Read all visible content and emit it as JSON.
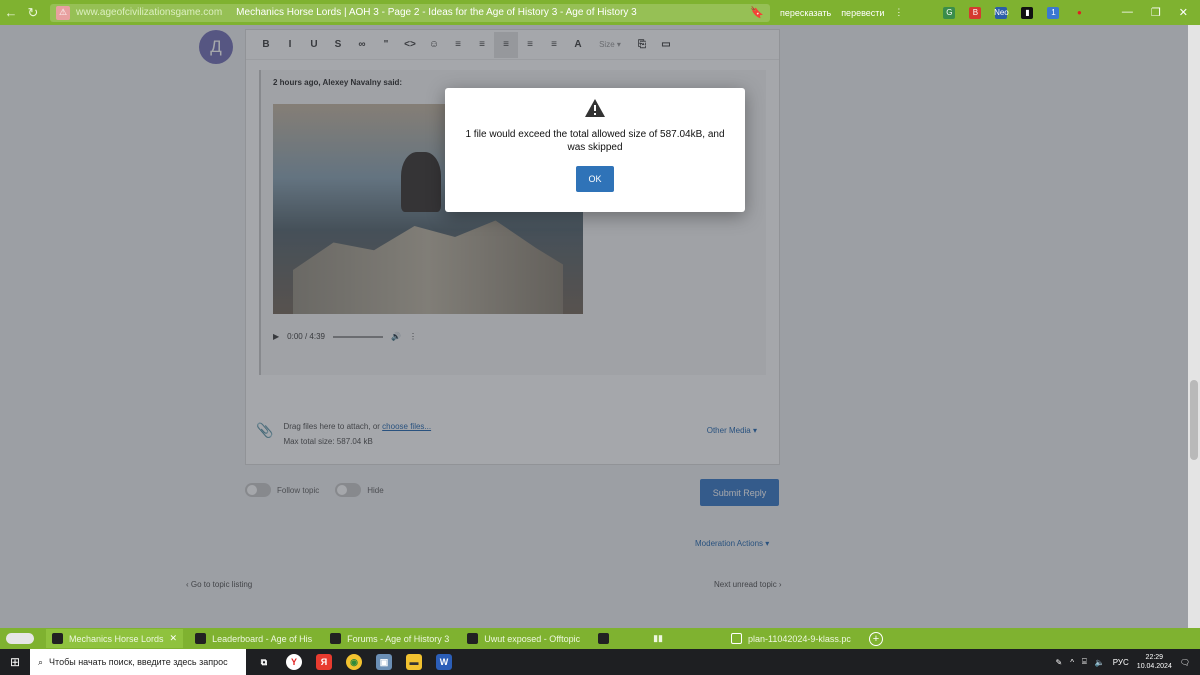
{
  "browser": {
    "back": "←",
    "reload": "↻",
    "warn": "⚠",
    "url_host": "www.ageofcivilizationsgame.com",
    "page_title": "Mechanics Horse Lords | AOH 3 - Page 2 - Ideas for the Age of History 3 - Age of History 3",
    "bookmark": "🔖",
    "ext_retell": "пересказать",
    "ext_translate": "перевести",
    "menu": "⋮",
    "ext_icons": [
      "G",
      "B",
      "Neo",
      "▮",
      "1",
      "●"
    ],
    "win_controls": [
      "—",
      "❐",
      "✕"
    ]
  },
  "page": {
    "avatar_letter": "Д",
    "toolbar": [
      "B",
      "I",
      "U",
      "S",
      "∞",
      "\"",
      "<>",
      "☺",
      "≡",
      "≡",
      "≡",
      "≡",
      "≡",
      "A",
      "Size ▾",
      "⎘",
      "▭"
    ],
    "quote_cite": "2 hours ago, Alexey Navalny said:",
    "audio_time": "0:00 / 4:39",
    "attach_text": "Drag files here to attach, or",
    "attach_link": "choose files...",
    "max_size": "Max total size: 587.04 kB",
    "other_media": "Other Media ▾",
    "follow_topic": "Follow topic",
    "hide": "Hide",
    "submit": "Submit Reply",
    "moderation": "Moderation Actions ▾",
    "goto_topic": "Go to topic listing",
    "next_topic": "Next unread topic"
  },
  "modal": {
    "message": "1 file would exceed the total allowed size of 587.04kB, and was skipped",
    "ok": "OK"
  },
  "tabs": [
    {
      "label": "Mechanics Horse Lords",
      "close": "✕",
      "active": true
    },
    {
      "label": "Leaderboard - Age of His",
      "active": false
    },
    {
      "label": "Forums - Age of History 3",
      "active": false
    },
    {
      "label": "Uwut exposed - Offtopic",
      "active": false
    },
    {
      "label": "",
      "active": false
    },
    {
      "label": "▮▮",
      "active": false
    },
    {
      "label": "plan-11042024-9-klass.pc",
      "active": false
    }
  ],
  "taskbar": {
    "search_placeholder": "Чтобы начать поиск, введите здесь запрос",
    "lang": "РУС",
    "time": "22:29",
    "date": "10.04.2024",
    "apps": [
      "Y",
      "Я",
      "◉",
      "▣",
      "▬",
      "W"
    ]
  },
  "colors": {
    "browser_green": "#7fb230",
    "primary_blue": "#2f73b8",
    "avatar_purple": "#7774b8"
  }
}
